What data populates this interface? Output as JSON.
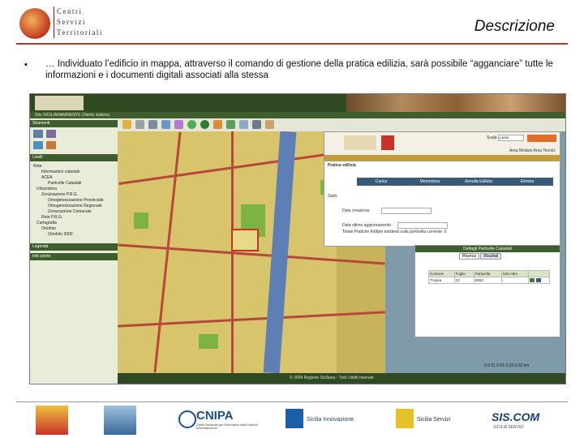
{
  "header": {
    "logo_lines": [
      "Centri",
      "Servizi",
      "Territoriali"
    ],
    "title": "Descrizione"
  },
  "bullet": {
    "marker": "•",
    "text": "… Individuato l’edificio in mappa, attraverso il comando di gestione della pratica edilizia, sarà possibile “agganciare” tutte le informazioni e i documenti digitali associati alla stessa"
  },
  "app": {
    "menu": "Sito   SICILIANAMBIENTE   Cliente sistema",
    "panel_titles": [
      "Strumenti",
      "Livelli",
      "Legenda",
      "Info ponte"
    ],
    "layers": [
      "Rete",
      "Informazioni catastali",
      "ACEA",
      "Particelle Catastali",
      "Urbanistica",
      "Zonizzazione P.R.G.",
      "Omogeneizzazione Provinciale",
      "Omogeneizzazione Regionale",
      "Zonizzazione Comunale",
      "Rete P.R.G.",
      "Cartografia",
      "Ortofoto",
      "Ortofoto 2000"
    ],
    "scale_label": "Scala",
    "scale_value": "1:4000",
    "user_links": "Area Modulo   Area Tecnici",
    "dialog_title": "Pratica edilizia",
    "dialog_buttons": [
      "Carica",
      "Memorizza",
      "Annulla Edilizia",
      "Elimina"
    ],
    "dialog_section": "Stato",
    "dialog_field_labels": [
      "Data creazione",
      "Data ultimo aggiornamento"
    ],
    "dialog_note": "Totale Pratiche Edilizie esistenti sulla particella corrente: 0",
    "table_panel_title": "Dettagli Particelle Catastali",
    "table_tabs": [
      "Ricerca",
      "Risultati"
    ],
    "table_headers": [
      "Comune",
      "Foglio",
      "Particella",
      "Sub Altro"
    ],
    "table_row": [
      "Tropea",
      "12",
      "0053",
      "-"
    ],
    "status_text": "© 2009 Regione Siciliana - Tutti i diritti riservati",
    "scalebar_ticks": [
      "0",
      "0.01",
      "0.01",
      "0.03",
      "0.02",
      "km"
    ]
  },
  "footer": {
    "cnipa": "CNIPA",
    "cnipa_sub": "Centro Nazionale per l'Informatica nella Pubblica Amministrazione",
    "sicilia_innovazione": "Sicilia Innovazione",
    "sicilia_servizi": "Sicilia Servizi",
    "siscom": "SIS.COM",
    "siscom_sub": "SICILIA SERVIZI"
  }
}
